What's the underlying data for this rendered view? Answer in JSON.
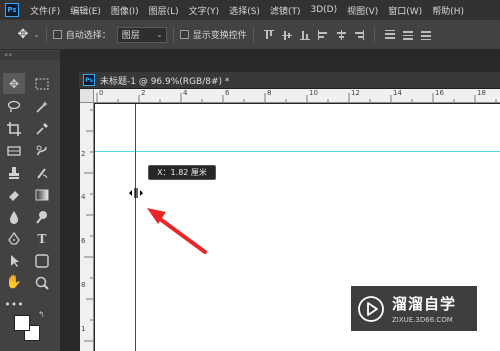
{
  "app": {
    "logo": "Ps"
  },
  "menu": [
    "文件(F)",
    "编辑(E)",
    "图像(I)",
    "图层(L)",
    "文字(Y)",
    "选择(S)",
    "滤镜(T)",
    "3D(D)",
    "视图(V)",
    "窗口(W)",
    "帮助(H)"
  ],
  "options": {
    "auto_select_label": "自动选择：",
    "auto_select_value": "图层",
    "show_transform_label": "显示变换控件"
  },
  "panel": {
    "collapse": "««"
  },
  "document": {
    "tab_title": "未标题-1 @ 96.9%(RGB/8#) *",
    "ruler_top_labels": [
      "0",
      "2",
      "4",
      "6",
      "8",
      "10",
      "12",
      "14",
      "16",
      "18"
    ],
    "ruler_left_labels": [
      "2",
      "4",
      "6",
      "8",
      "1"
    ],
    "tooltip": "X：1.82 厘米"
  },
  "colors": {
    "foreground": "#ffffff",
    "background": "#ffffff",
    "guide": "#5ad8e6",
    "arrow": "#e8262a",
    "ps_blue": "#31a8ff"
  },
  "watermark": {
    "name": "溜溜自学",
    "url": "ZIXUE.3D66.COM"
  }
}
